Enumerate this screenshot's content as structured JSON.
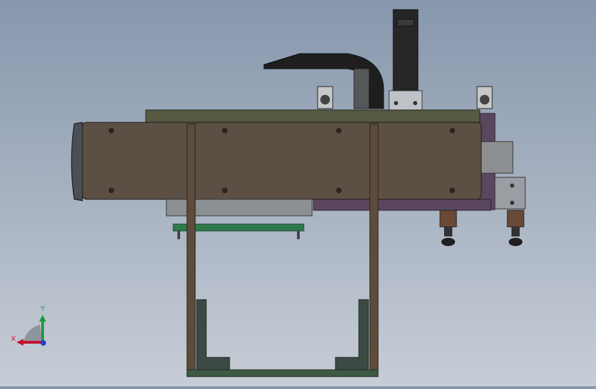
{
  "viewport": {
    "background_top": "#8797ad",
    "background_bottom": "#c7cdd6"
  },
  "triad": {
    "x_label": "X",
    "y_label": "Y",
    "x_color": "#c8102e",
    "y_color": "#1a9b3a",
    "z_color": "#1d3fd0"
  },
  "model": {
    "beam_color": "#5c5045",
    "top_plate_color": "#555a40",
    "frame_color": "#5d4b3b",
    "bracket_color": "#3c4a44",
    "plate_green": "#2e7a4d",
    "purple_plate": "#5b4660",
    "motor_color": "#2a2a2a",
    "suction_color": "#6a4a35"
  }
}
